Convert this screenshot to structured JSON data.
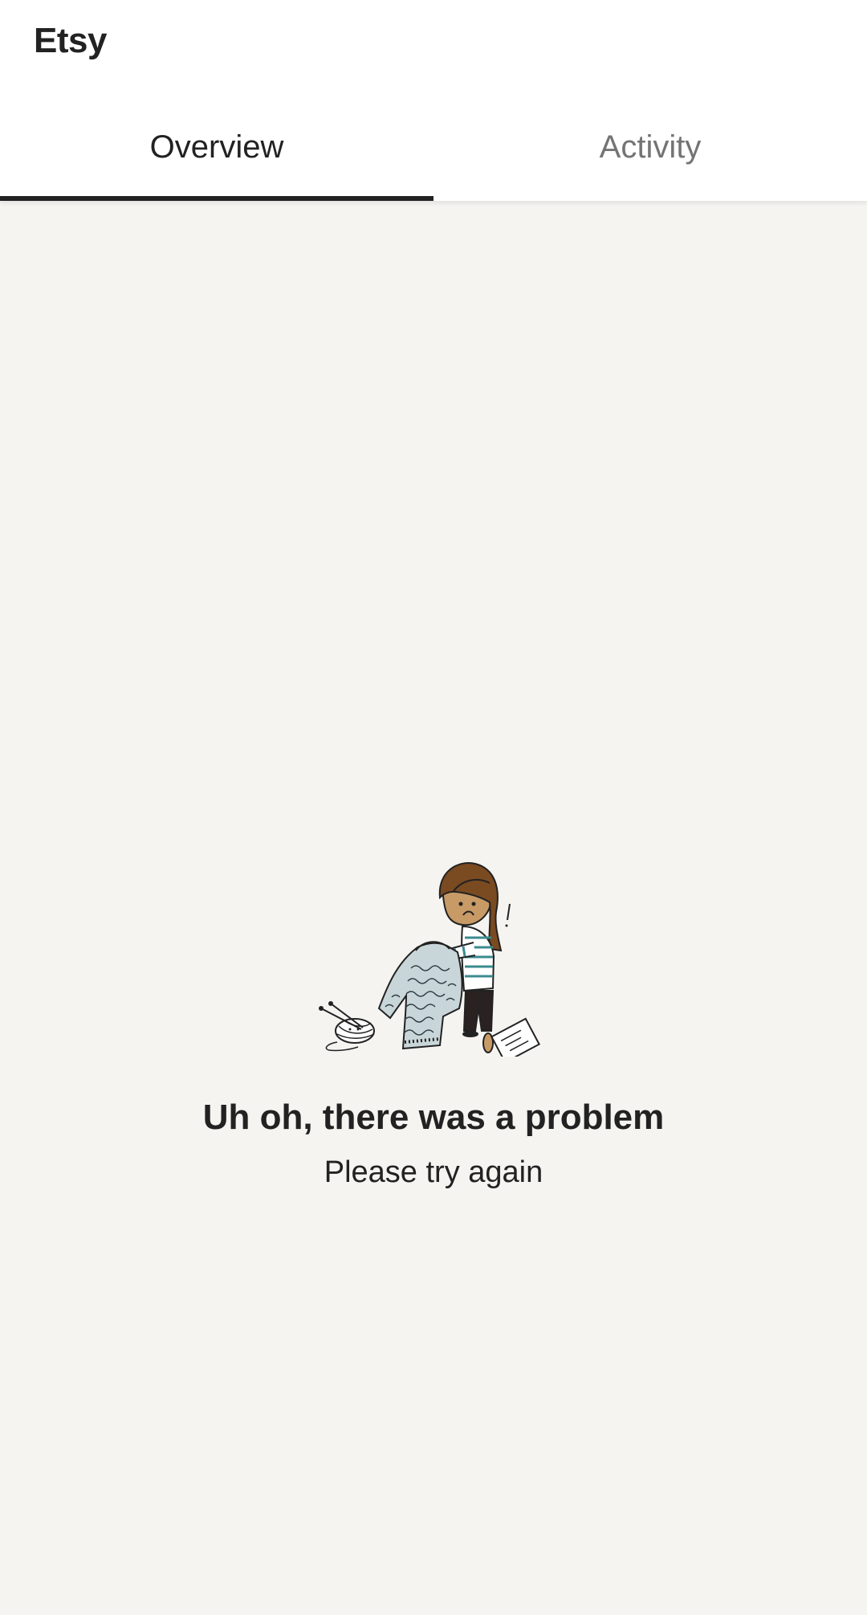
{
  "app": {
    "title": "Etsy"
  },
  "tabs": [
    {
      "label": "Overview",
      "active": true
    },
    {
      "label": "Activity",
      "active": false
    }
  ],
  "error": {
    "title": "Uh oh, there was a problem",
    "subtitle": "Please try again",
    "illustration_icon": "knitting-error-illustration-icon"
  },
  "colors": {
    "header_bg": "#ffffff",
    "page_bg": "#f5f4f1",
    "text_primary": "#222222",
    "text_inactive": "#747474",
    "tab_indicator": "#222222"
  }
}
